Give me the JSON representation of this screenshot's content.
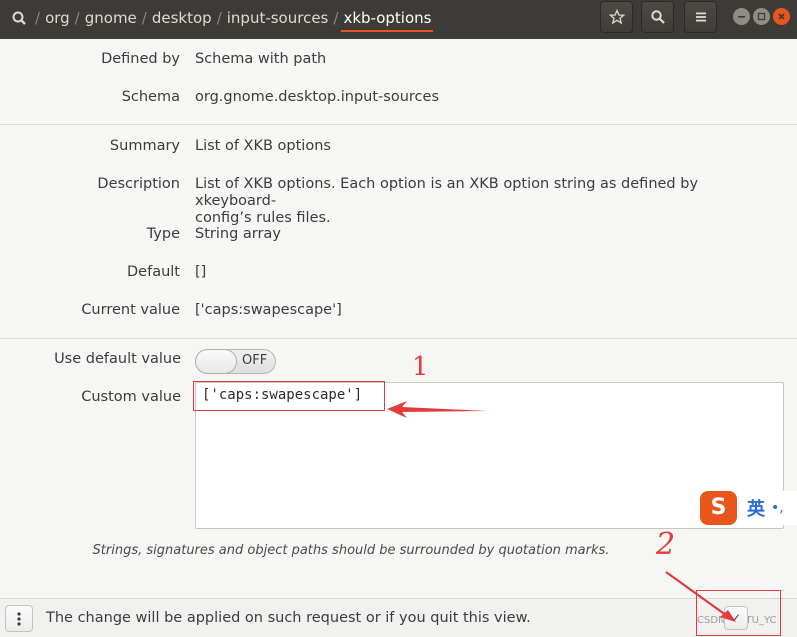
{
  "header": {
    "breadcrumbs": [
      "org",
      "gnome",
      "desktop",
      "input-sources"
    ],
    "current": "xkb-options",
    "separator": "/",
    "buttons": [
      "star-icon",
      "search-icon",
      "hamburger-menu-icon"
    ],
    "window_controls": [
      "minimize",
      "maximize",
      "close"
    ]
  },
  "details": [
    {
      "label": "Defined by",
      "value": "Schema with path"
    },
    {
      "label": "Schema",
      "value": "org.gnome.desktop.input-sources"
    },
    {
      "label": "Summary",
      "value": "List of XKB options"
    },
    {
      "label": "Description",
      "value": "List of XKB options. Each option is an XKB option string as defined by xkeyboard-",
      "value2": "config’s rules files."
    },
    {
      "label": "Type",
      "value": "String array"
    },
    {
      "label": "Default",
      "value": "[]"
    },
    {
      "label": "Current value",
      "value": "['caps:swapescape']"
    }
  ],
  "settings": {
    "use_default_label": "Use default value",
    "toggle_state": "OFF",
    "custom_label": "Custom value",
    "custom_value": "['caps:swapescape']"
  },
  "hint": "Strings, signatures and object paths should be surrounded by quotation marks.",
  "bottom": {
    "message": "The change will be applied on such request or if you quit this view.",
    "apply_icon": "✓",
    "watermark": "CSDN @BTU_YC"
  },
  "ime": {
    "logo": "S",
    "lang": "英",
    "punc": "•,"
  },
  "annotations": {
    "mark1": "1",
    "mark2": "2"
  },
  "colors": {
    "accent": "#e95420",
    "annotation_red": "#e03c3c",
    "header_bg": "#3c3b37"
  }
}
